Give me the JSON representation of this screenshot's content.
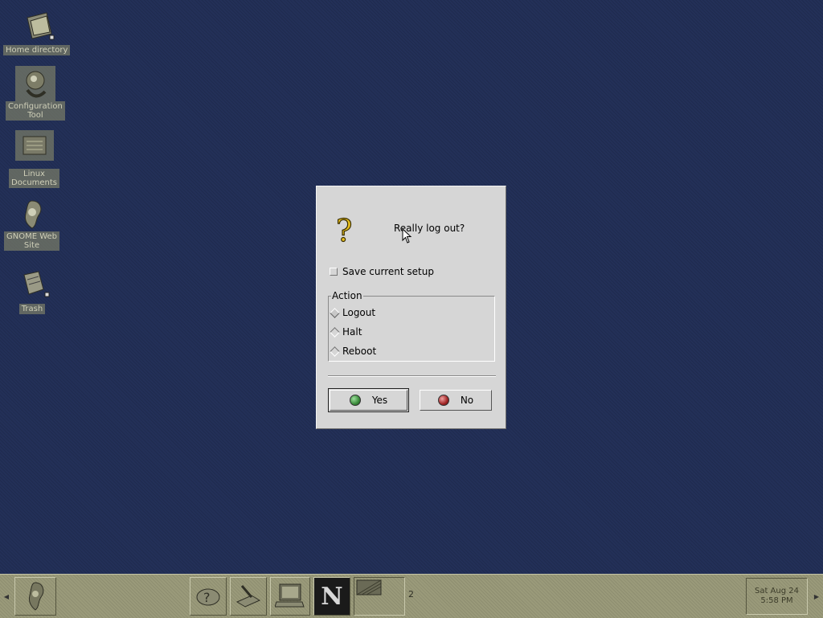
{
  "desktop": {
    "icons": [
      {
        "label": "Home directory"
      },
      {
        "label": "Configuration\nTool"
      },
      {
        "label": "Linux\nDocuments"
      },
      {
        "label": "GNOME Web\nSite"
      },
      {
        "label": "Trash"
      }
    ]
  },
  "dialog": {
    "message": "Really log out?",
    "save_setup": "Save current setup",
    "action_title": "Action",
    "options": [
      {
        "label": "Logout",
        "selected": true
      },
      {
        "label": "Halt",
        "selected": false
      },
      {
        "label": "Reboot",
        "selected": false
      }
    ],
    "yes_label": "Yes",
    "no_label": "No"
  },
  "panel": {
    "clock_line1": "Sat Aug 24",
    "clock_line2": "5:58 PM",
    "pager_label": "N",
    "pager_count": "2"
  },
  "colors": {
    "desktop": "#233058",
    "dialog": "#d6d6d6",
    "yes": "#3a8a3a",
    "no": "#a02424"
  }
}
